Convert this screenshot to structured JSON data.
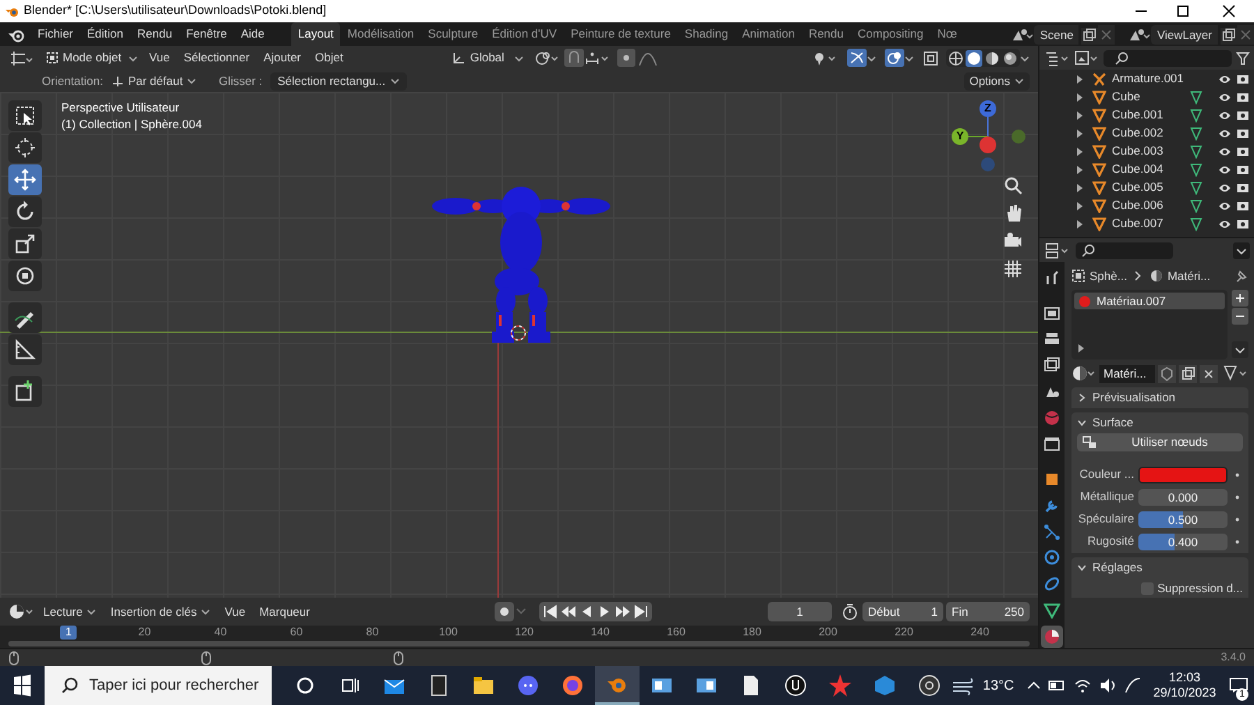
{
  "window": {
    "title": "Blender* [C:\\Users\\utilisateur\\Downloads\\Potoki.blend]"
  },
  "menu": [
    "Fichier",
    "Édition",
    "Rendu",
    "Fenêtre",
    "Aide"
  ],
  "workspaces": [
    {
      "label": "Layout",
      "selected": true
    },
    {
      "label": "Modélisation",
      "selected": false
    },
    {
      "label": "Sculpture",
      "selected": false
    },
    {
      "label": "Édition d'UV",
      "selected": false
    },
    {
      "label": "Peinture de texture",
      "selected": false
    },
    {
      "label": "Shading",
      "selected": false
    },
    {
      "label": "Animation",
      "selected": false
    },
    {
      "label": "Rendu",
      "selected": false
    },
    {
      "label": "Compositing",
      "selected": false
    },
    {
      "label": "Nœ",
      "selected": false
    }
  ],
  "scene": "Scene",
  "view_layer": "ViewLayer",
  "viewport_header": {
    "mode": "Mode objet",
    "menus": [
      "Vue",
      "Sélectionner",
      "Ajouter",
      "Objet"
    ],
    "orientation": "Global"
  },
  "tool_settings": {
    "orientation_label": "Orientation:",
    "orientation": "Par défaut",
    "drag_label": "Glisser :",
    "drag": "Sélection rectangu...",
    "options": "Options"
  },
  "viewport": {
    "view_name": "Perspective Utilisateur",
    "collection": "(1) Collection | Sphère.004",
    "axis_labels": {
      "z": "Z",
      "y": "Y"
    }
  },
  "toolbar": [
    {
      "kind": "select",
      "selected": false
    },
    {
      "kind": "cursor",
      "selected": false
    },
    {
      "kind": "move",
      "selected": true
    },
    {
      "kind": "rotate",
      "selected": false
    },
    {
      "kind": "scale",
      "selected": false
    },
    {
      "kind": "transform",
      "selected": false
    },
    {
      "kind": "annotate",
      "selected": false
    },
    {
      "kind": "measure",
      "selected": false
    },
    {
      "kind": "add",
      "selected": false
    }
  ],
  "outliner": {
    "rows": [
      {
        "name": "Armature.001",
        "kind": "armature"
      },
      {
        "name": "Cube",
        "kind": "mesh"
      },
      {
        "name": "Cube.001",
        "kind": "mesh"
      },
      {
        "name": "Cube.002",
        "kind": "mesh"
      },
      {
        "name": "Cube.003",
        "kind": "mesh"
      },
      {
        "name": "Cube.004",
        "kind": "mesh"
      },
      {
        "name": "Cube.005",
        "kind": "mesh"
      },
      {
        "name": "Cube.006",
        "kind": "mesh"
      },
      {
        "name": "Cube.007",
        "kind": "mesh"
      }
    ]
  },
  "properties": {
    "tabs": [
      {
        "kind": "tool",
        "selected": false
      },
      {
        "kind": "render",
        "selected": false
      },
      {
        "kind": "output",
        "selected": false
      },
      {
        "kind": "view_layer",
        "selected": false
      },
      {
        "kind": "scene",
        "selected": false
      },
      {
        "kind": "world",
        "selected": false
      },
      {
        "kind": "collection",
        "selected": false
      },
      {
        "kind": "object",
        "selected": false
      },
      {
        "kind": "modifiers",
        "selected": false
      },
      {
        "kind": "particles",
        "selected": false
      },
      {
        "kind": "physics",
        "selected": false
      },
      {
        "kind": "constraints",
        "selected": false
      },
      {
        "kind": "data",
        "selected": false
      },
      {
        "kind": "material",
        "selected": true
      }
    ],
    "breadcrumb": [
      "Sphè...",
      "Matéri..."
    ],
    "slots": [
      {
        "name": "Matériau.007",
        "selected": true
      }
    ],
    "material_name": "Matéri...",
    "preview_panel": {
      "title": "Prévisualisation",
      "expanded": false
    },
    "surface_panel": {
      "title": "Surface",
      "expanded": true,
      "use_nodes": "Utiliser nœuds",
      "fields": [
        {
          "kind": "color",
          "label": "Couleur ...",
          "color": "#e51414"
        },
        {
          "kind": "slider",
          "label": "Métallique",
          "value": "0.000",
          "level": 0
        },
        {
          "kind": "slider",
          "label": "Spéculaire",
          "value": "0.500",
          "level": 0.5
        },
        {
          "kind": "slider",
          "label": "Rugosité",
          "value": "0.400",
          "level": 0.4
        }
      ]
    },
    "settings_panel": {
      "title": "Réglages",
      "expanded": true,
      "checkbox": {
        "label": "Suppression d...",
        "checked": false
      }
    }
  },
  "timeline": {
    "menus": [
      "Lecture",
      "Insertion de clés",
      "Vue",
      "Marqueur"
    ],
    "current_frame": "1",
    "start_label": "Début",
    "start": "1",
    "end_label": "Fin",
    "end": "250",
    "ruler": [
      {
        "label": "1",
        "selected": true
      },
      {
        "label": "20",
        "selected": false
      },
      {
        "label": "40",
        "selected": false
      },
      {
        "label": "60",
        "selected": false
      },
      {
        "label": "80",
        "selected": false
      },
      {
        "label": "100",
        "selected": false
      },
      {
        "label": "120",
        "selected": false
      },
      {
        "label": "140",
        "selected": false
      },
      {
        "label": "160",
        "selected": false
      },
      {
        "label": "180",
        "selected": false
      },
      {
        "label": "200",
        "selected": false
      },
      {
        "label": "220",
        "selected": false
      },
      {
        "label": "240",
        "selected": false
      }
    ]
  },
  "status_bar": {
    "version": "3.4.0"
  },
  "taskbar": {
    "search_placeholder": "Taper ici pour rechercher",
    "temperature": "13°C",
    "time": "12:03",
    "date": "29/10/2023",
    "notifications": "1"
  }
}
